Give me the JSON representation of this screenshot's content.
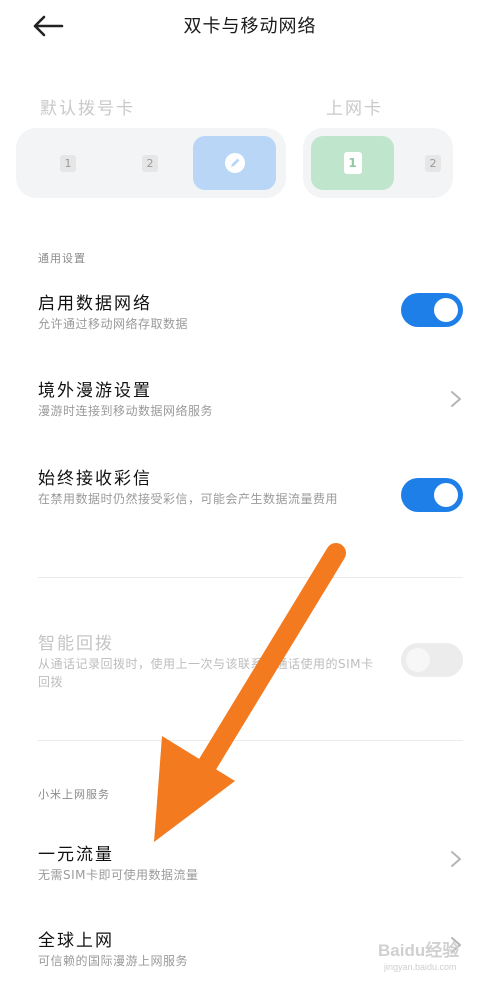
{
  "header": {
    "title": "双卡与移动网络"
  },
  "sim": {
    "default_dial_label": "默认拨号卡",
    "data_card_label": "上网卡",
    "dial_options": [
      "1",
      "2"
    ],
    "data_options": [
      "1",
      "2"
    ],
    "colors": {
      "dial_selected": "#b9d6f7",
      "data_selected": "#bfe6cc"
    }
  },
  "general": {
    "header": "通用设置",
    "enable_data": {
      "title": "启用数据网络",
      "subtitle": "允许通过移动网络存取数据",
      "on": true
    },
    "roaming": {
      "title": "境外漫游设置",
      "subtitle": "漫游时连接到移动数据网络服务"
    },
    "mms": {
      "title": "始终接收彩信",
      "subtitle": "在禁用数据时仍然接受彩信，可能会产生数据流量费用",
      "on": true
    },
    "smart_redial": {
      "title": "智能回拨",
      "subtitle": "从通话记录回拨时，使用上一次与该联系人通话使用的SIM卡回拨",
      "on": false
    }
  },
  "xiaomi": {
    "header": "小米上网服务",
    "one_yuan": {
      "title": "一元流量",
      "subtitle": "无需SIM卡即可使用数据流量"
    },
    "global": {
      "title": "全球上网",
      "subtitle": "可信赖的国际漫游上网服务"
    }
  },
  "watermark": {
    "logo": "Baidu经验",
    "url": "jingyan.baidu.com"
  },
  "colors": {
    "accent": "#1f7fe8",
    "arrow": "#f47a20"
  }
}
